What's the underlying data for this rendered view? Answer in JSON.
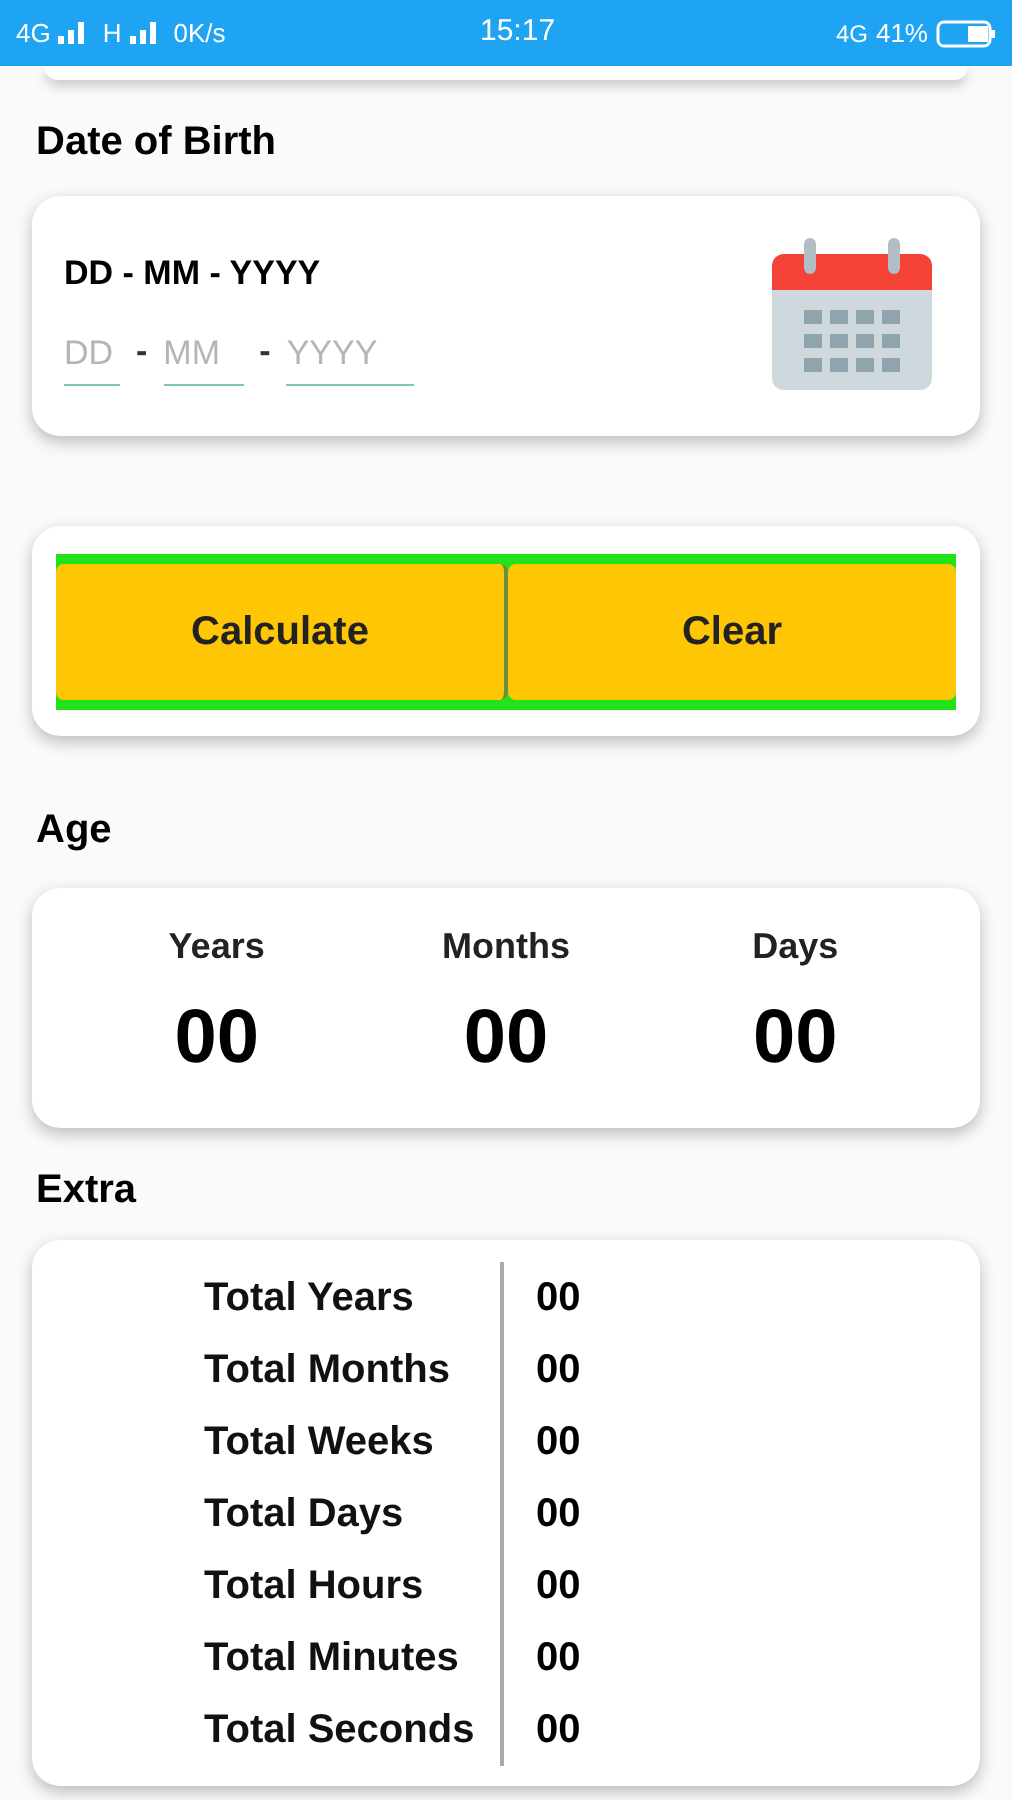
{
  "status_bar": {
    "network_1": "4G",
    "network_2": "H",
    "speed": "0K/s",
    "time": "15:17",
    "network_3": "4G",
    "battery": "41%"
  },
  "date_of_birth": {
    "label": "Date of Birth",
    "format": "DD - MM - YYYY",
    "fields": [
      {
        "placeholder": "DD"
      },
      {
        "placeholder": "MM"
      },
      {
        "placeholder": "YYYY"
      }
    ],
    "separators": [
      "-",
      "-"
    ]
  },
  "buttons": [
    "Calculate",
    "Clear"
  ],
  "age": {
    "label": "Age",
    "items": [
      {
        "label": "Years",
        "value": "00"
      },
      {
        "label": "Months",
        "value": "00"
      },
      {
        "label": "Days",
        "value": "00"
      }
    ]
  },
  "extra": {
    "label": "Extra",
    "rows": [
      {
        "label": "Total Years",
        "value": "00"
      },
      {
        "label": "Total Months",
        "value": "00"
      },
      {
        "label": "Total Weeks",
        "value": "00"
      },
      {
        "label": "Total Days",
        "value": "00"
      },
      {
        "label": "Total Hours",
        "value": "00"
      },
      {
        "label": "Total Minutes",
        "value": "00"
      },
      {
        "label": "Total Seconds",
        "value": "00"
      }
    ]
  }
}
